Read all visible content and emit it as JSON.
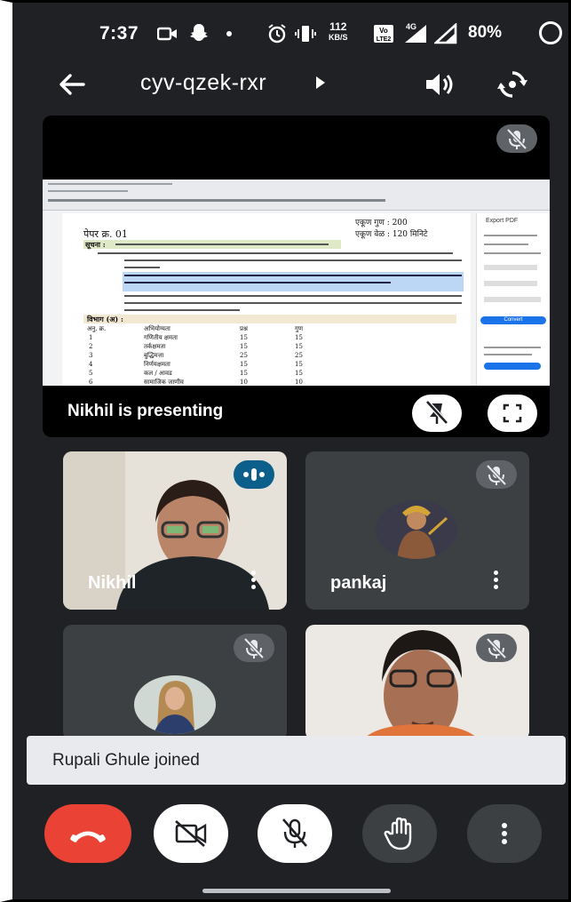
{
  "status_bar": {
    "time": "7:37",
    "net_speed": "112",
    "net_unit": "KB/S",
    "volte": "Vo₂ LTE2",
    "network": "4G",
    "battery": "80%"
  },
  "topbar": {
    "meeting_code": "cyv-qzek-rxr"
  },
  "presenting": {
    "label": "Nikhil is presenting",
    "doc": {
      "paper_no": "पेपर क्र. 01",
      "total_marks": "एकूण गुण : 200",
      "total_time": "एकूण वेळ : 120 मिनिटे",
      "notice": "सूचना :",
      "section": "विभाग (अ) :",
      "col_sr": "अनु. क्र.",
      "col_subject": "अभियोग्यता",
      "col_questions": "प्रश्न",
      "col_marks": "गुण",
      "rows": [
        {
          "sr": "1",
          "subject": "गणितीय क्षमता",
          "q": "15",
          "m": "15"
        },
        {
          "sr": "2",
          "subject": "तर्कक्षमता",
          "q": "15",
          "m": "15"
        },
        {
          "sr": "3",
          "subject": "बुद्धिमत्ता",
          "q": "25",
          "m": "25"
        },
        {
          "sr": "4",
          "subject": "निर्णयक्षमता",
          "q": "15",
          "m": "15"
        },
        {
          "sr": "5",
          "subject": "कल / आवड",
          "q": "15",
          "m": "15"
        },
        {
          "sr": "6",
          "subject": "सामाजिक जाणीव",
          "q": "10",
          "m": "10"
        }
      ],
      "side_title": "Export PDF",
      "side_button": "Convert"
    }
  },
  "participants": [
    {
      "name": "Nikhil",
      "state": "speaking"
    },
    {
      "name": "pankaj",
      "state": "muted"
    },
    {
      "name": "",
      "state": "muted"
    },
    {
      "name": "",
      "state": "muted"
    }
  ],
  "toast": {
    "text": "Rupali Ghule joined"
  },
  "colors": {
    "background": "#202124",
    "end_call": "#ea4335",
    "speaking": "#0b5f8a",
    "tile": "#3c4043"
  }
}
